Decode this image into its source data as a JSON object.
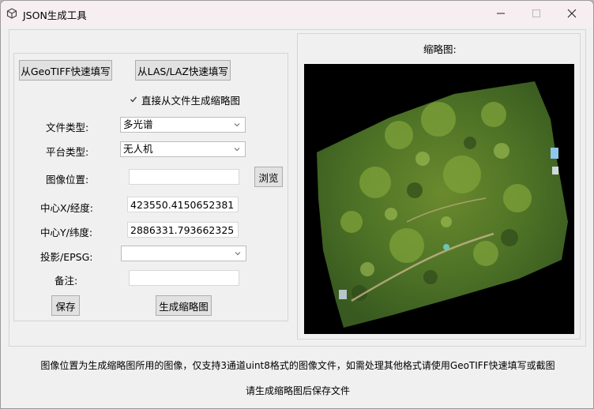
{
  "window": {
    "title": "JSON生成工具"
  },
  "buttons": {
    "from_geotiff": "从GeoTIFF快速填写",
    "from_las": "从LAS/LAZ快速填写",
    "browse": "浏览",
    "save": "保存",
    "generate_thumbnail": "生成缩略图"
  },
  "checkbox": {
    "label": "直接从文件生成缩略图",
    "checked": true
  },
  "form": {
    "file_type_label": "文件类型:",
    "file_type_value": "多光谱",
    "platform_type_label": "平台类型:",
    "platform_type_value": "无人机",
    "image_location_label": "图像位置:",
    "image_location_value": "",
    "center_x_label": "中心X/经度:",
    "center_x_value": "423550.4150652381",
    "center_y_label": "中心Y/纬度:",
    "center_y_value": "2886331.793662325",
    "epsg_label": "投影/EPSG:",
    "epsg_value": "",
    "note_label": "备注:",
    "note_value": ""
  },
  "thumbnail": {
    "title": "缩略图:"
  },
  "status": {
    "line1": "图像位置为生成缩略图所用的图像，仅支持3通道uint8格式的图像文件，如需处理其他格式请使用GeoTIFF快速填写或截图",
    "line2": "请生成缩略图后保存文件"
  },
  "icons": [
    "app-cube-icon",
    "minimize-icon",
    "maximize-icon",
    "close-icon",
    "chevron-down-icon",
    "checkmark-icon"
  ]
}
